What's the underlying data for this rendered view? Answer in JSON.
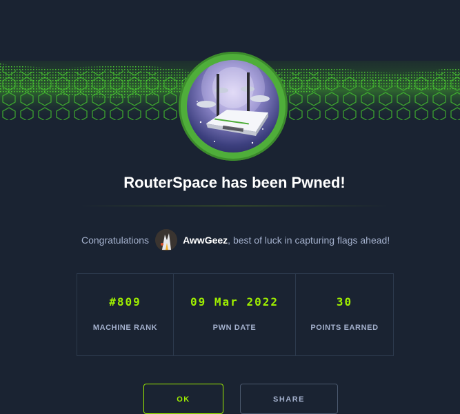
{
  "banner": {
    "icon": "green-hexagon-pattern"
  },
  "machine": {
    "avatar_icon": "router-icon",
    "title": "RouterSpace has been Pwned!"
  },
  "congrats": {
    "prefix": "Congratulations",
    "username": "AwwGeez",
    "suffix": ", best of luck in capturing flags ahead!"
  },
  "stats": [
    {
      "value": "#809",
      "label": "MACHINE RANK"
    },
    {
      "value": "09 Mar 2022",
      "label": "PWN DATE"
    },
    {
      "value": "30",
      "label": "POINTS EARNED"
    }
  ],
  "buttons": {
    "ok_label": "OK",
    "share_label": "SHARE"
  },
  "colors": {
    "background": "#1a2332",
    "accent": "#9fef00",
    "muted_text": "#a4b1cd",
    "ring": "#4fae3a"
  }
}
